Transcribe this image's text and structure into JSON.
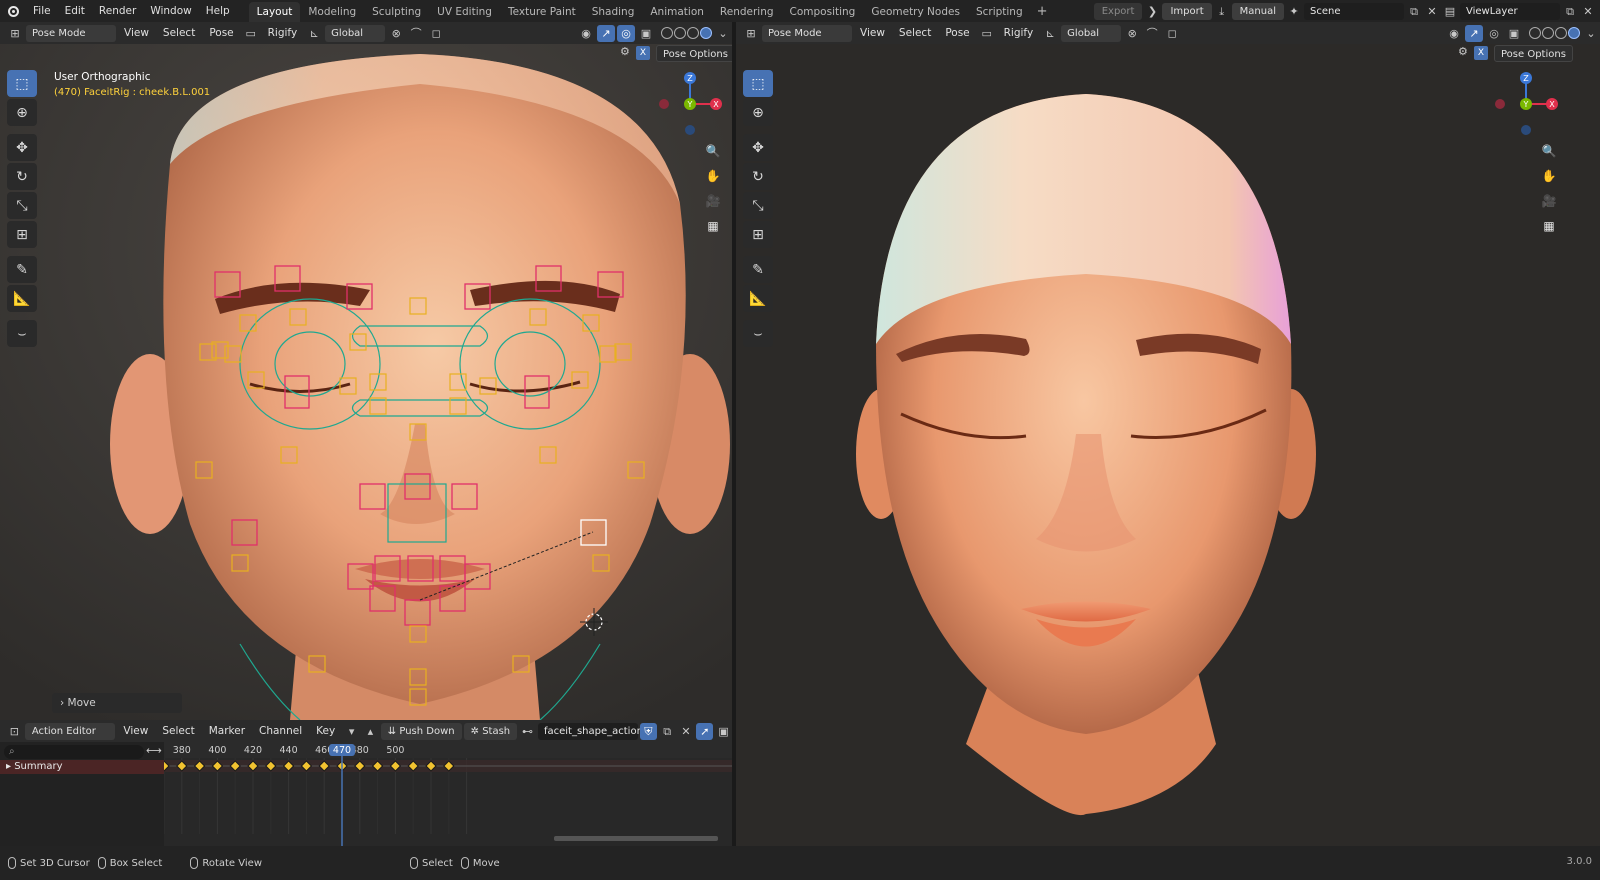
{
  "topbar": {
    "menus": [
      "File",
      "Edit",
      "Render",
      "Window",
      "Help"
    ],
    "workspaces": [
      "Layout",
      "Modeling",
      "Sculpting",
      "UV Editing",
      "Texture Paint",
      "Shading",
      "Animation",
      "Rendering",
      "Compositing",
      "Geometry Nodes",
      "Scripting"
    ],
    "active_workspace": "Layout",
    "add_label": "+",
    "export_label": "Export",
    "import_label": "Import",
    "manual_label": "Manual",
    "scene": "Scene",
    "view_layer": "ViewLayer"
  },
  "left_view": {
    "mode": "Pose Mode",
    "menus": [
      "View",
      "Select",
      "Pose"
    ],
    "rigify": "Rigify",
    "orientation": "Global",
    "pose_options": "Pose Options",
    "x_label": "X",
    "view_name": "User Orthographic",
    "object_info": "(470) FaceitRig : cheek.B.L.001",
    "last_op": "Move"
  },
  "right_view": {
    "mode": "Pose Mode",
    "menus": [
      "View",
      "Select",
      "Pose"
    ],
    "rigify": "Rigify",
    "orientation": "Global",
    "pose_options": "Pose Options",
    "x_label": "X"
  },
  "gizmo": {
    "z": "Z",
    "y": "Y",
    "x": "X"
  },
  "action_editor": {
    "mode": "Action Editor",
    "menus": [
      "View",
      "Select",
      "Marker",
      "Channel",
      "Key"
    ],
    "push_down": "Push Down",
    "stash": "Stash",
    "action_name": "faceit_shape_action",
    "summary_label": "Summary",
    "frame_ticks": [
      "380",
      "400",
      "420",
      "440",
      "460",
      "480",
      "500"
    ],
    "current_frame": "470"
  },
  "statusbar": {
    "items": [
      "Set 3D Cursor",
      "Box Select",
      "Rotate View",
      "Select",
      "Move"
    ],
    "version": "3.0.0"
  },
  "colors": {
    "accent": "#4772b3",
    "bone_pink": "#e0306a",
    "bone_yellow": "#e8b020",
    "bone_green": "#1fa890",
    "keyframe": "#f2c230"
  }
}
